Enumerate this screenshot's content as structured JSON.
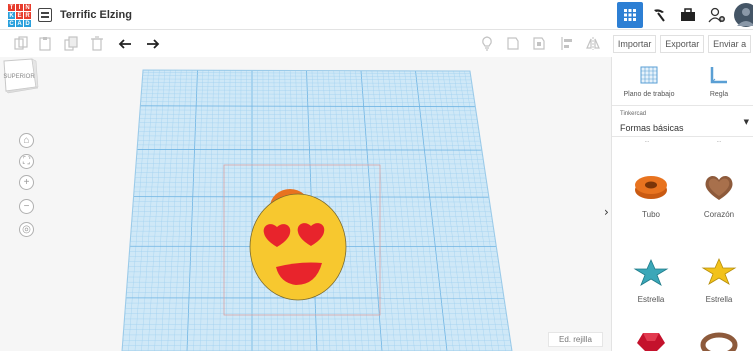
{
  "app": {
    "logo_letters": [
      "T",
      "I",
      "N",
      "K",
      "E",
      "R",
      "C",
      "A",
      "D"
    ],
    "logo_colors": [
      "#e73c2d",
      "#e73c2d",
      "#e73c2d",
      "#2aa0dc",
      "#e73c2d",
      "#e73c2d",
      "#2aa0dc",
      "#2aa0dc",
      "#2aa0dc"
    ],
    "title": "Terrific Elzing",
    "accent": "#2d7fd4"
  },
  "topbar": {
    "icons": [
      "grid-view-icon",
      "pickaxe-icon",
      "briefcase-icon",
      "add-user-icon",
      "avatar"
    ]
  },
  "toolbar": {
    "left_tools": [
      "copy-icon",
      "paste-icon",
      "duplicate-icon",
      "delete-icon",
      "undo-icon",
      "redo-icon"
    ],
    "right_tools": [
      "light-bulb-icon",
      "show-all-icon",
      "hide-icon",
      "align-icon",
      "mirror-icon"
    ]
  },
  "actions": {
    "import": "Importar",
    "export": "Exportar",
    "send": "Enviar a"
  },
  "view": {
    "cube_label": "SUPERIOR",
    "grid_label": "Ed. rejilla"
  },
  "panel": {
    "tools": {
      "workplane": "Plano de trabajo",
      "ruler": "Regla"
    },
    "library": {
      "provider": "Tinkercad",
      "selected": "Formas básicas"
    },
    "cut_labels": [
      "...",
      "..."
    ],
    "shapes": [
      {
        "label": "Tubo",
        "icon": "tube-shape-icon",
        "color": "#e8731f"
      },
      {
        "label": "Corazón",
        "icon": "heart-shape-icon",
        "color": "#8d5a3b"
      },
      {
        "label": "Estrella",
        "icon": "star-teal-shape-icon",
        "color": "#3ba7b8"
      },
      {
        "label": "Estrella",
        "icon": "star-yellow-shape-icon",
        "color": "#f2c21b"
      }
    ]
  },
  "model": {
    "face_color": "#f7c82f",
    "eye_color": "#e8242c",
    "ring_color": "#e8731f"
  }
}
